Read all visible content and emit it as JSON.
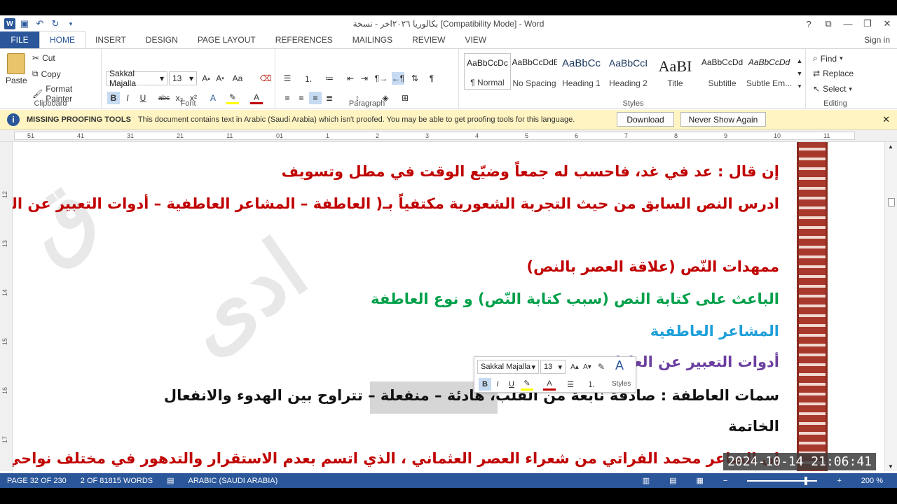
{
  "window": {
    "title": "بكالوريا ٢٠٢٦اخر - نسخة [Compatibility Mode] - Word",
    "help": "?",
    "controls": [
      "⧉",
      "—",
      "❐",
      "✕"
    ]
  },
  "quick_access": {
    "save": "💾",
    "undo": "↶",
    "redo": "↻"
  },
  "tabs": [
    "FILE",
    "HOME",
    "INSERT",
    "DESIGN",
    "PAGE LAYOUT",
    "REFERENCES",
    "MAILINGS",
    "REVIEW",
    "VIEW"
  ],
  "active_tab": "HOME",
  "signin": "Sign in",
  "clipboard": {
    "paste": "Paste",
    "cut": "Cut",
    "copy": "Copy",
    "format_painter": "Format Painter",
    "label": "Clipboard"
  },
  "font": {
    "family": "Sakkal Majalla",
    "size": "13",
    "label": "Font"
  },
  "paragraph": {
    "label": "Paragraph"
  },
  "styles": {
    "label": "Styles",
    "items": [
      {
        "preview": "AaBbCcDc",
        "name": "¶ Normal"
      },
      {
        "preview": "AaBbCcDdE",
        "name": "No Spacing"
      },
      {
        "preview": "AaBbCc",
        "name": "Heading 1"
      },
      {
        "preview": "AaBbCcI",
        "name": "Heading 2"
      },
      {
        "preview": "AaBI",
        "name": "Title"
      },
      {
        "preview": "AaBbCcDd",
        "name": "Subtitle"
      },
      {
        "preview": "AaBbCcDd",
        "name": "Subtle Em..."
      }
    ]
  },
  "editing": {
    "find": "Find",
    "replace": "Replace",
    "select": "Select",
    "label": "Editing"
  },
  "message_bar": {
    "title": "MISSING PROOFING TOOLS",
    "text": "This document contains text in Arabic (Saudi Arabia) which isn't proofed. You may be able to get proofing tools for this language.",
    "download": "Download",
    "never": "Never Show Again"
  },
  "ruler_numbers": [
    "51",
    "41",
    "31",
    "21",
    "11",
    "01",
    "1",
    "2",
    "3",
    "4",
    "5",
    "6",
    "7",
    "8",
    "9",
    "10",
    "11"
  ],
  "vruler_numbers": [
    "12",
    "13",
    "14",
    "15",
    "16",
    "17"
  ],
  "document": {
    "lines": [
      {
        "text": "إن قال : عد في غد، فاحسب له جمعاً           وضيّع الوقت في مطل وتسويف",
        "color": "#c00000"
      },
      {
        "text": "ادرس النص السابق من حيث التجربة الشعورية مكتفياً بـ( العاطفة – المشاعر العاطفية – أدوات التعبير عن العاطفة",
        "color": "#c00000"
      },
      {
        "text": "ممهدات النّص (علاقة العصر بالنص)",
        "color": "#c00000"
      },
      {
        "text": "الباعث على كتابة النص (سبب كتابة النّص) و نوع العاطفة",
        "color": "#00a04a"
      },
      {
        "text": "المشاعر العاطفية",
        "color": "#1ea0d8"
      },
      {
        "text": "أدوات التعبير عن العاطفة",
        "color": "#6b3fa0"
      },
      {
        "text": "سمات العاطفة : صادقة نابعة من القلب، هادئة – منفعلة – تتراوح بين الهدوء والانفعال",
        "color": "#111111"
      },
      {
        "text": "الخاتمة",
        "color": "#111111"
      },
      {
        "text": "إن الشاعر محمد الفراتي من شعراء العصر العثماني ، الذي اتسم بعدم الاستقرار والتدهور في مختلف نواحي الحياة",
        "color": "#c00000"
      }
    ]
  },
  "mini_toolbar": {
    "font": "Sakkal Majalla",
    "size": "13",
    "styles": "Styles"
  },
  "status": {
    "page": "PAGE 32 OF 230",
    "words": "2 OF 81815 WORDS",
    "language": "ARABIC (SAUDI ARABIA)",
    "zoom": "200 %"
  },
  "timestamp": "2024-10-14  21:06:41"
}
